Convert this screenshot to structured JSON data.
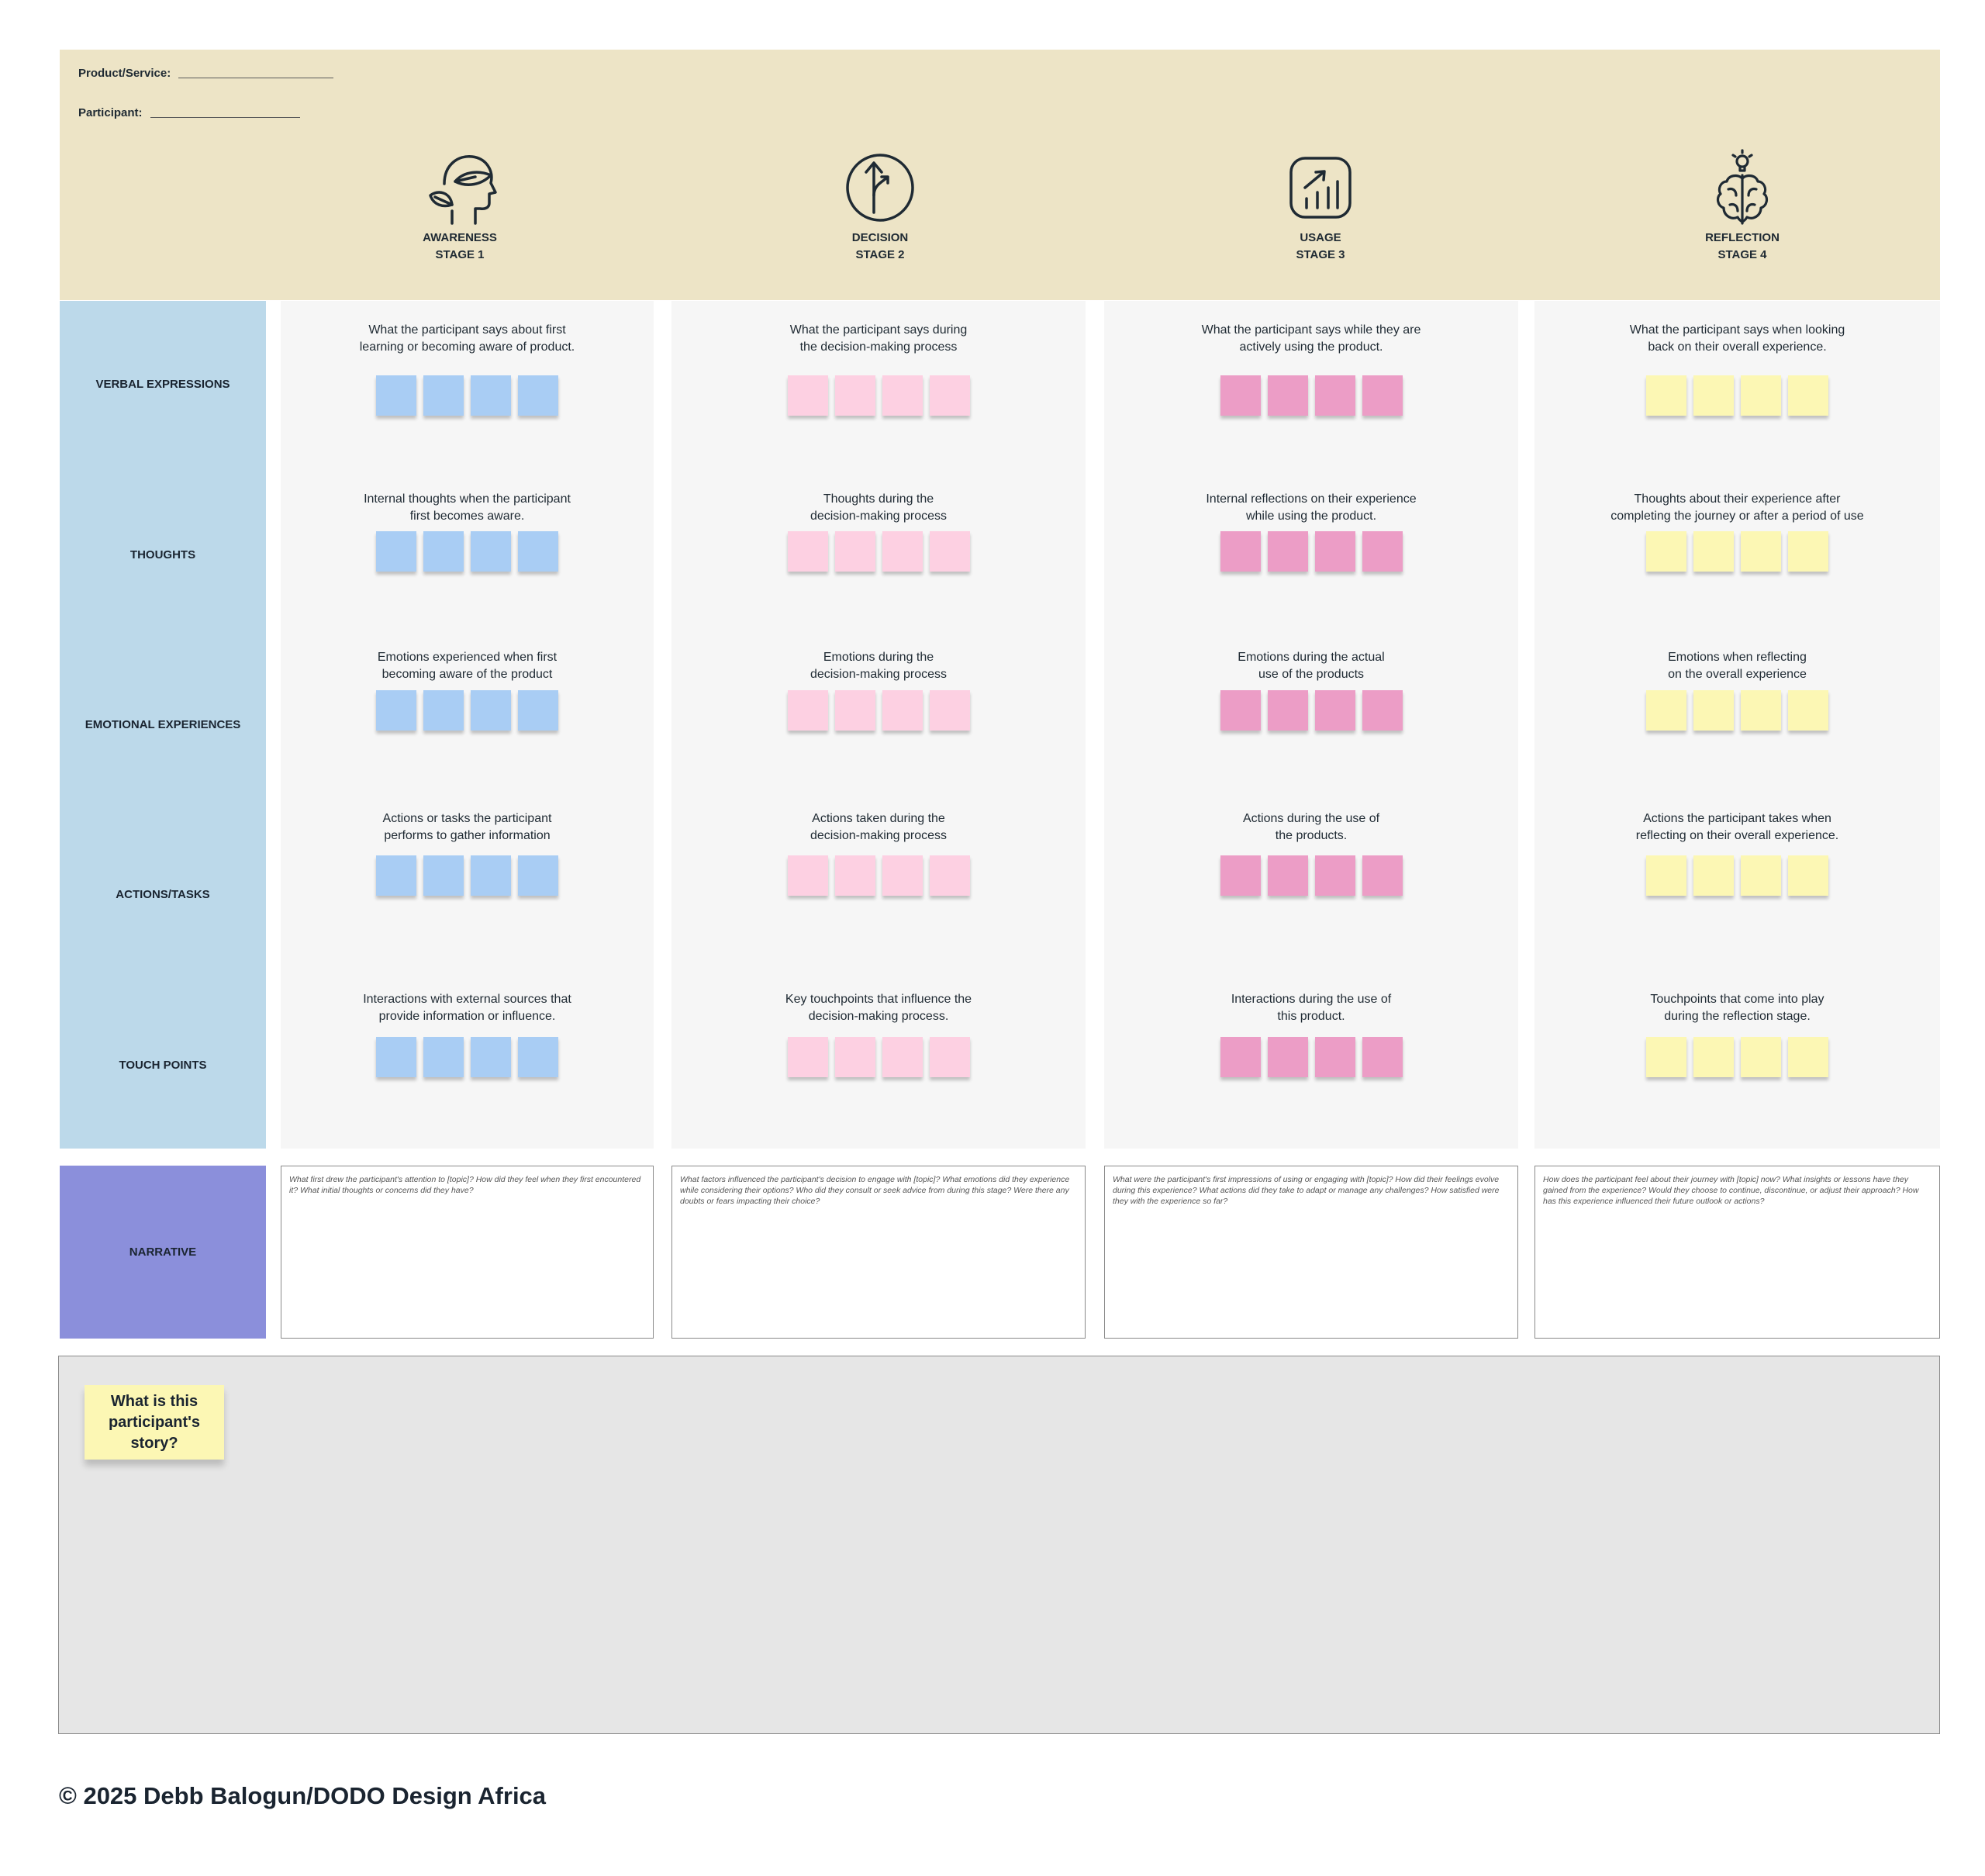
{
  "header": {
    "product_label": "Product/Service:",
    "participant_label": "Participant:"
  },
  "stages": [
    {
      "name": "AWARENESS",
      "stage": "STAGE 1",
      "icon": "head-leaf-icon"
    },
    {
      "name": "DECISION",
      "stage": "STAGE 2",
      "icon": "split-arrow-icon"
    },
    {
      "name": "USAGE",
      "stage": "STAGE 3",
      "icon": "growth-chart-icon"
    },
    {
      "name": "REFLECTION",
      "stage": "STAGE 4",
      "icon": "brain-bulb-icon"
    }
  ],
  "rows": [
    {
      "label": "VERBAL EXPRESSIONS"
    },
    {
      "label": "THOUGHTS"
    },
    {
      "label": "EMOTIONAL EXPERIENCES"
    },
    {
      "label": "ACTIONS/TASKS"
    },
    {
      "label": "TOUCH POINTS"
    }
  ],
  "cells": [
    [
      {
        "l1": "What the participant says about first",
        "l2": "learning or becoming aware of product."
      },
      {
        "l1": "Internal thoughts when the participant",
        "l2": "first becomes aware."
      },
      {
        "l1": "Emotions experienced when first",
        "l2": "becoming aware of the product"
      },
      {
        "l1": "Actions or tasks the participant",
        "l2": "performs to gather information"
      },
      {
        "l1": "Interactions with external sources that",
        "l2": "provide information or influence."
      }
    ],
    [
      {
        "l1": "What the participant says during",
        "l2": "the decision-making process"
      },
      {
        "l1": "Thoughts during the",
        "l2": "decision-making process"
      },
      {
        "l1": "Emotions during the",
        "l2": "decision-making process"
      },
      {
        "l1": "Actions taken during the",
        "l2": "decision-making process"
      },
      {
        "l1": "Key touchpoints that influence the",
        "l2": "decision-making process."
      }
    ],
    [
      {
        "l1": "What the participant says while they are",
        "l2": "actively using the product."
      },
      {
        "l1": "Internal reflections on their experience",
        "l2": "while using the product."
      },
      {
        "l1": "Emotions during the actual",
        "l2": "use of the products"
      },
      {
        "l1": "Actions during the use of",
        "l2": "the products."
      },
      {
        "l1": "Interactions during the use of",
        "l2": "this product."
      }
    ],
    [
      {
        "l1": "What the participant says when looking",
        "l2": "back on their overall experience."
      },
      {
        "l1": "Thoughts about their experience after",
        "l2": "completing the journey or after a period of use"
      },
      {
        "l1": "Emotions when reflecting",
        "l2": "on the overall experience"
      },
      {
        "l1": "Actions the participant takes when",
        "l2": "reflecting on their overall experience."
      },
      {
        "l1": "Touchpoints that come into play",
        "l2": "during the reflection stage."
      }
    ]
  ],
  "note_colors": [
    "#a9cdf4",
    "#fdd0e2",
    "#ec9dc6",
    "#fcf7b4"
  ],
  "narrative": {
    "label": "NARRATIVE",
    "prompts": [
      "What first drew the participant's attention to [topic]? How did they feel when they first encountered it? What initial thoughts or concerns did they have?",
      "What factors influenced the participant's decision to engage with [topic]? What emotions did they experience while considering their options? Who did they consult or seek advice from during this stage? Were there any doubts or fears impacting their choice?",
      "What were the participant's first impressions of using or engaging with [topic]? How did their feelings evolve during this experience? What actions did they take to adapt or manage any challenges? How satisfied were they with the experience so far?",
      "How does the participant feel about their journey with [topic] now? What insights or lessons have they gained from the experience? Would they choose to continue, discontinue, or adjust their approach? How has this experience influenced their future outlook or actions?"
    ]
  },
  "story": {
    "prompt": "What is this participant's story?"
  },
  "footer": {
    "copyright": "© 2025 Debb Balogun/DODO Design Africa"
  }
}
